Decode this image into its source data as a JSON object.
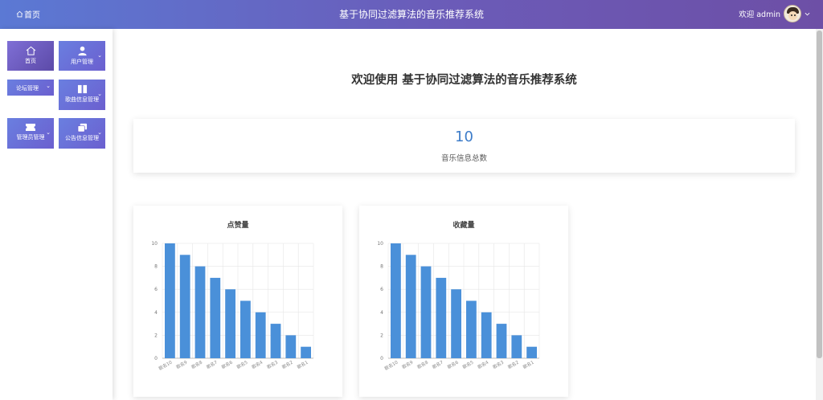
{
  "header": {
    "home_icon": "home-outline-icon",
    "home_label": "首页",
    "title": "基于协同过滤算法的音乐推荐系统",
    "welcome_user": "欢迎 admin",
    "avatar_icon": "avatar-image",
    "dropdown_icon": "chevron-down-icon"
  },
  "sidebar": {
    "items": [
      {
        "label": "首页",
        "icon": "home-icon"
      },
      {
        "label": "用户管理",
        "icon": "user-icon"
      },
      {
        "label": "论坛管理",
        "icon": ""
      },
      {
        "label": "歌曲信息管理",
        "icon": "book-icon"
      },
      {
        "label": "管理员管理",
        "icon": "ticket-icon"
      },
      {
        "label": "公告信息管理",
        "icon": "copy-icon"
      }
    ]
  },
  "main": {
    "welcome": "欢迎使用 基于协同过滤算法的音乐推荐系统",
    "stat_value": "10",
    "stat_label": "音乐信息总数"
  },
  "colors": {
    "bar": "#4a90d9",
    "header_start": "#5b79d4",
    "header_end": "#6d4fa6",
    "stat_number": "#3d7cc9"
  },
  "chart_data": [
    {
      "type": "bar",
      "title": "点赞量",
      "categories": [
        "歌名10",
        "歌名9",
        "歌名8",
        "歌名7",
        "歌名6",
        "歌名5",
        "歌名4",
        "歌名3",
        "歌名2",
        "歌名1"
      ],
      "values": [
        10,
        9,
        8,
        7,
        6,
        5,
        4,
        3,
        2,
        1
      ],
      "ylim": [
        0,
        10
      ],
      "yticks": [
        0,
        2,
        4,
        6,
        8,
        10
      ],
      "grid": true
    },
    {
      "type": "bar",
      "title": "收藏量",
      "categories": [
        "歌名10",
        "歌名9",
        "歌名8",
        "歌名7",
        "歌名6",
        "歌名5",
        "歌名4",
        "歌名3",
        "歌名2",
        "歌名1"
      ],
      "values": [
        10,
        9,
        8,
        7,
        6,
        5,
        4,
        3,
        2,
        1
      ],
      "ylim": [
        0,
        10
      ],
      "yticks": [
        0,
        2,
        4,
        6,
        8,
        10
      ],
      "grid": true
    }
  ]
}
